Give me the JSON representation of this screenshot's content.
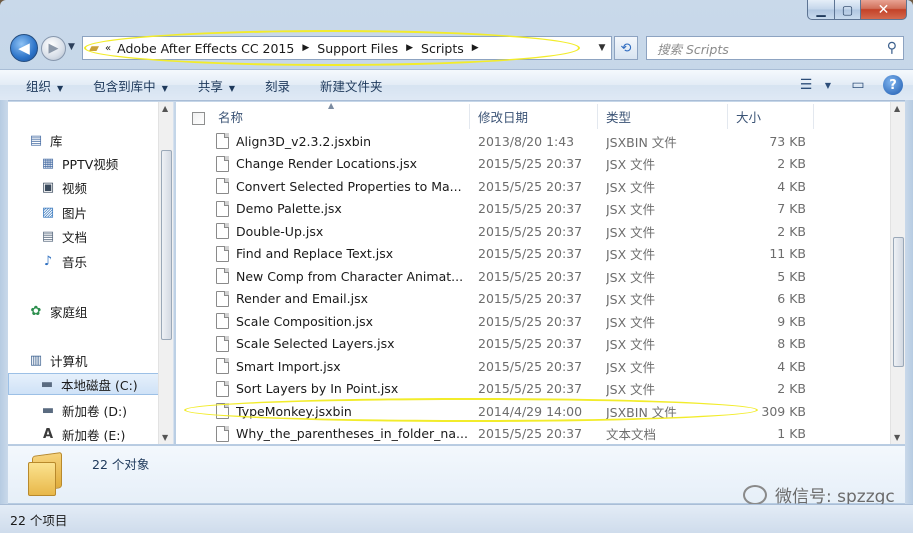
{
  "address": {
    "crumbs": [
      "Adobe After Effects CC 2015",
      "Support Files",
      "Scripts"
    ],
    "prefix": "«"
  },
  "search": {
    "placeholder": "搜索 Scripts"
  },
  "commands": [
    {
      "label": "组织",
      "has_arrow": true
    },
    {
      "label": "包含到库中",
      "has_arrow": true
    },
    {
      "label": "共享",
      "has_arrow": true
    },
    {
      "label": "刻录",
      "has_arrow": false
    },
    {
      "label": "新建文件夹",
      "has_arrow": false
    }
  ],
  "nav": {
    "items": [
      {
        "label": "库",
        "icon": "library-icon",
        "indent": 0
      },
      {
        "label": "PPTV视频",
        "icon": "video-library-icon",
        "indent": 1
      },
      {
        "label": "视频",
        "icon": "video-icon",
        "indent": 1
      },
      {
        "label": "图片",
        "icon": "pictures-icon",
        "indent": 1
      },
      {
        "label": "文档",
        "icon": "documents-icon",
        "indent": 1
      },
      {
        "label": "音乐",
        "icon": "music-icon",
        "indent": 1
      },
      {
        "label": "家庭组",
        "icon": "homegroup-icon",
        "indent": 0
      },
      {
        "label": "计算机",
        "icon": "computer-icon",
        "indent": 0
      },
      {
        "label": "本地磁盘 (C:)",
        "icon": "drive-icon",
        "indent": 1,
        "selected": true
      },
      {
        "label": "新加卷 (D:)",
        "icon": "drive-icon",
        "indent": 1
      },
      {
        "label": "新加卷 (E:)",
        "icon": "drive-icon",
        "indent": 1
      }
    ]
  },
  "columns": {
    "name": "名称",
    "date": "修改日期",
    "type": "类型",
    "size": "大小"
  },
  "files": [
    {
      "name": "Align3D_v2.3.2.jsxbin",
      "date": "2013/8/20 1:43",
      "type": "JSXBIN 文件",
      "size": "73 KB"
    },
    {
      "name": "Change Render Locations.jsx",
      "date": "2015/5/25 20:37",
      "type": "JSX 文件",
      "size": "2 KB"
    },
    {
      "name": "Convert Selected Properties to Ma...",
      "date": "2015/5/25 20:37",
      "type": "JSX 文件",
      "size": "4 KB"
    },
    {
      "name": "Demo Palette.jsx",
      "date": "2015/5/25 20:37",
      "type": "JSX 文件",
      "size": "7 KB"
    },
    {
      "name": "Double-Up.jsx",
      "date": "2015/5/25 20:37",
      "type": "JSX 文件",
      "size": "2 KB"
    },
    {
      "name": "Find and Replace Text.jsx",
      "date": "2015/5/25 20:37",
      "type": "JSX 文件",
      "size": "11 KB"
    },
    {
      "name": "New Comp from Character Animat...",
      "date": "2015/5/25 20:37",
      "type": "JSX 文件",
      "size": "5 KB"
    },
    {
      "name": "Render and Email.jsx",
      "date": "2015/5/25 20:37",
      "type": "JSX 文件",
      "size": "6 KB"
    },
    {
      "name": "Scale Composition.jsx",
      "date": "2015/5/25 20:37",
      "type": "JSX 文件",
      "size": "9 KB"
    },
    {
      "name": "Scale Selected Layers.jsx",
      "date": "2015/5/25 20:37",
      "type": "JSX 文件",
      "size": "8 KB"
    },
    {
      "name": "Smart Import.jsx",
      "date": "2015/5/25 20:37",
      "type": "JSX 文件",
      "size": "4 KB"
    },
    {
      "name": "Sort Layers by In Point.jsx",
      "date": "2015/5/25 20:37",
      "type": "JSX 文件",
      "size": "2 KB"
    },
    {
      "name": "TypeMonkey.jsxbin",
      "date": "2014/4/29 14:00",
      "type": "JSXBIN 文件",
      "size": "309 KB"
    },
    {
      "name": "Why_the_parentheses_in_folder_na...",
      "date": "2015/5/25 20:37",
      "type": "文本文档",
      "size": "1 KB"
    }
  ],
  "details": {
    "count": "22 个对象"
  },
  "status": {
    "text": "22 个项目"
  },
  "watermark": {
    "text": "微信号: spzzgc"
  },
  "colors": {
    "highlight_ellipse": "#f2ec2b",
    "selected_nav": "#cfe2f7"
  }
}
